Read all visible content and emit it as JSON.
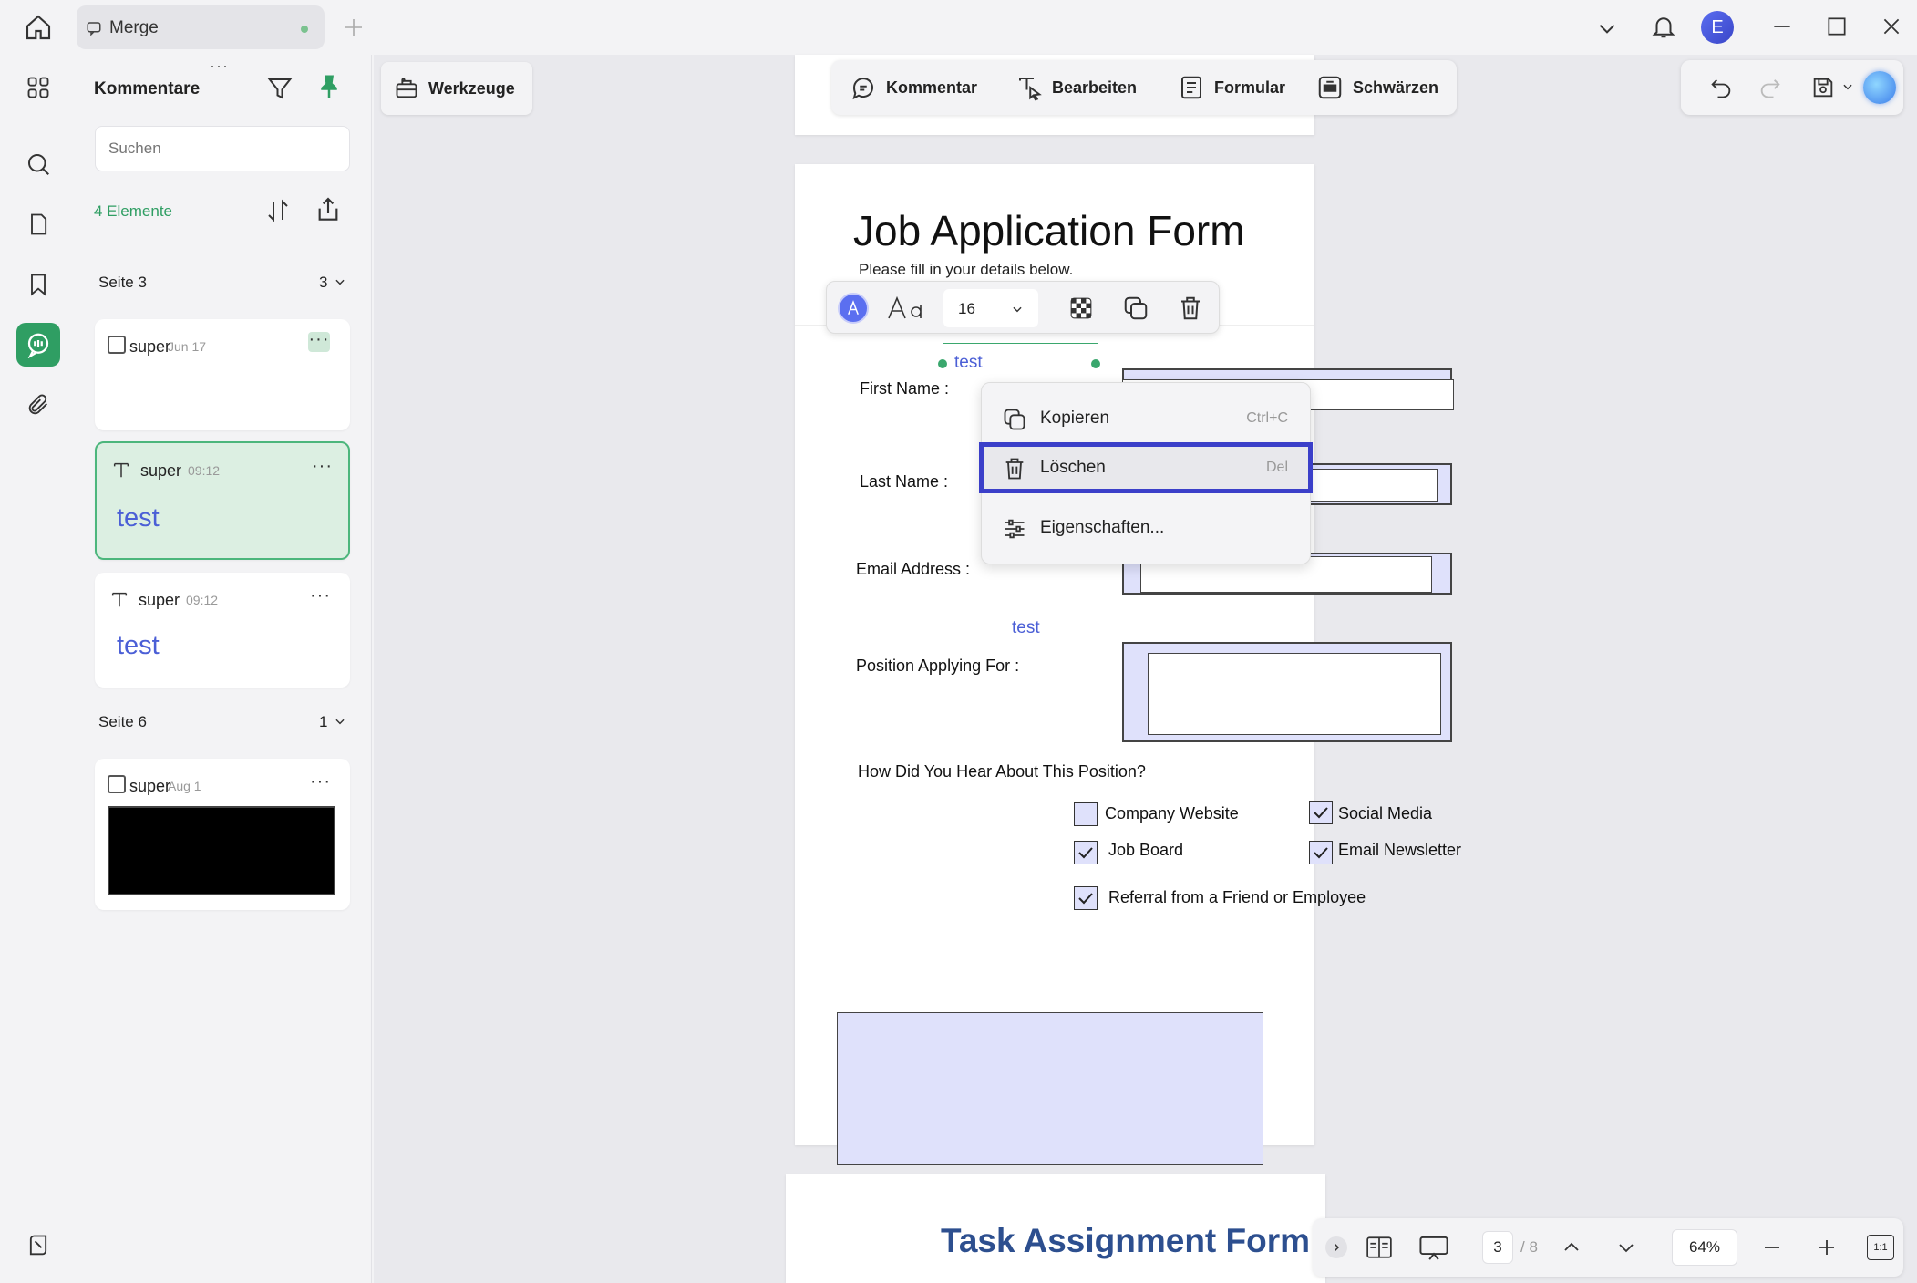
{
  "titlebar": {
    "tab_label": "Merge",
    "avatar_letter": "E"
  },
  "panel": {
    "title": "Kommentare",
    "search_placeholder": "Suchen",
    "count_label": "4 Elemente",
    "groups": [
      {
        "label": "Seite 3",
        "count": "3"
      },
      {
        "label": "Seite 6",
        "count": "1"
      }
    ],
    "comments": [
      {
        "author": "super",
        "time": "Jun 17",
        "text": ""
      },
      {
        "author": "super",
        "time": "09:12",
        "text": "test"
      },
      {
        "author": "super",
        "time": "09:12",
        "text": "test"
      },
      {
        "author": "super",
        "time": "Aug 1",
        "text": ""
      }
    ],
    "more_label": "···"
  },
  "workspace": {
    "tools_label": "Werkzeuge",
    "modes": [
      "Kommentar",
      "Bearbeiten",
      "Formular",
      "Schwärzen"
    ]
  },
  "text_toolbar": {
    "font_size": "16"
  },
  "form": {
    "title": "Job Application Form",
    "subtitle": "Please fill in your details below.",
    "labels": {
      "first_name": "First Name :",
      "last_name": "Last Name :",
      "email": "Email Address :",
      "position": "Position Applying For :",
      "how": "How Did You Hear About This Position?"
    },
    "annotation_text_1": "test",
    "annotation_text_2": "test",
    "checkboxes": [
      {
        "label": "Company Website",
        "checked": false
      },
      {
        "label": "Social Media",
        "checked": true
      },
      {
        "label": "Job Board",
        "checked": true
      },
      {
        "label": "Email Newsletter",
        "checked": true
      },
      {
        "label": "Referral from a Friend or Employee",
        "checked": true
      }
    ]
  },
  "next_page": {
    "title": "Task Assignment Form"
  },
  "context_menu": {
    "items": [
      {
        "label": "Kopieren",
        "shortcut": "Ctrl+C"
      },
      {
        "label": "Löschen",
        "shortcut": "Del"
      },
      {
        "label": "Eigenschaften...",
        "shortcut": ""
      }
    ]
  },
  "bottombar": {
    "current_page": "3",
    "total_pages": "/ 8",
    "zoom": "64%",
    "fit_label": "1:1"
  },
  "colors": {
    "accent": "#2f9e63",
    "highlight": "#3b3fc9",
    "field_fill": "#dfe1fb",
    "annotation_text": "#4b5fd6",
    "next_title": "#2d4f8f"
  }
}
